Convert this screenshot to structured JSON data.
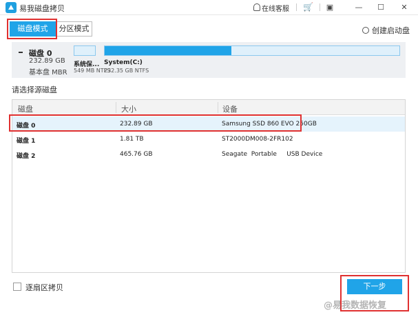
{
  "app": {
    "title": "易我磁盘拷贝"
  },
  "titlebar": {
    "service_label": "在线客服",
    "icons": [
      "app-logo-icon",
      "headset-icon",
      "cart-icon",
      "restore-icon",
      "minimize-icon",
      "maximize-icon",
      "close-icon"
    ],
    "minimize": "—",
    "maximize": "☐",
    "close": "✕",
    "restore": "▣",
    "cart": "🛒"
  },
  "tabs": [
    {
      "label": "磁盘模式",
      "active": true
    },
    {
      "label": "分区模式",
      "active": false
    }
  ],
  "create_boot_label": "创建启动盘",
  "disk_overview": {
    "name": "磁盘 0",
    "size": "232.89 GB",
    "type": "基本盘 MBR",
    "partitions": [
      {
        "name": "系统保...",
        "info": "549 MB NTFS",
        "fill": 0
      },
      {
        "name": "System(C:)",
        "info": "232.35 GB NTFS",
        "fill": 0.43
      }
    ]
  },
  "section_label": "请选择源磁盘",
  "table": {
    "headers": [
      "磁盘",
      "大小",
      "设备"
    ],
    "rows": [
      {
        "disk": "磁盘 0",
        "size": "232.89 GB",
        "device": "Samsung SSD 860 EVO 250GB",
        "selected": true
      },
      {
        "disk": "磁盘 1",
        "size": "1.81 TB",
        "device": "ST2000DM008-2FR102",
        "selected": false
      },
      {
        "disk": "磁盘 2",
        "size": "465.76 GB",
        "device": "Seagate  Portable     USB Device",
        "selected": false
      }
    ]
  },
  "sector_copy_label": "逐扇区拷贝",
  "next_button": "下一步",
  "watermark": "@易我数据恢复",
  "colors": {
    "accent": "#20a4e8",
    "highlight": "#e03030",
    "selected_row": "#e5f3fc"
  }
}
